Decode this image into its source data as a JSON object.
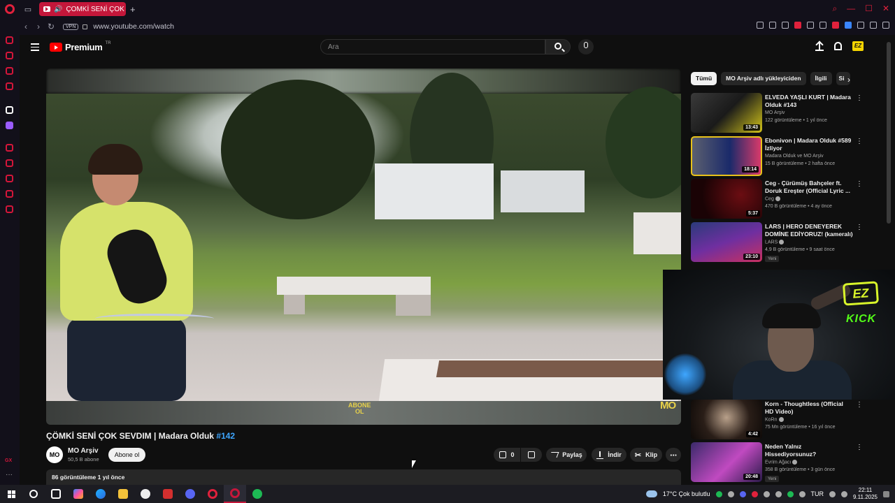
{
  "browser": {
    "tab_title": "ÇOMKİ SENİ ÇOK SEV",
    "new_tab_symbol": "+",
    "vpn_label": "VPN",
    "url": "www.youtube.com/watch",
    "accent_color": "#c4173a"
  },
  "header": {
    "logo_text": "Premium",
    "logo_region": "TR",
    "search_placeholder": "Ara"
  },
  "video": {
    "title": "ÇÖMKİ SENİ ÇOK SEVDIM | Madara Olduk",
    "tag": "#142",
    "watermark": "MO",
    "channel_name": "MO Arşiv",
    "channel_subs": "50,5 B abone",
    "channel_avatar": "MO",
    "subscribe_label": "Abone ol",
    "likes": "0",
    "share_label": "Paylaş",
    "download_label": "İndir",
    "clip_label": "Klip",
    "views_line": "86 görüntüleme  1 yıl önce"
  },
  "chips": [
    "Tümü",
    "MO Arşiv adlı yükleyiciden",
    "İlgili",
    "Si"
  ],
  "recommendations": [
    {
      "title": "ELVEDA YAŞLI KURT | Madara Olduk #143",
      "channel": "MO Arşiv",
      "meta": "122 görüntüleme • 1 yıl önce",
      "duration": "13:43",
      "verified": false,
      "badge": ""
    },
    {
      "title": "Ebonivon | Madara Olduk #589 İzliyor",
      "channel": "Madara Olduk ve MO Arşiv",
      "meta": "15 B görüntüleme • 2 hafta önce",
      "duration": "18:14",
      "verified": false,
      "badge": ""
    },
    {
      "title": "Ceg - Çürümüş Bahçeler ft. Doruk Ereşter (Official Lyric ...",
      "channel": "Ceg",
      "meta": "470 B görüntüleme • 4 ay önce",
      "duration": "5:37",
      "verified": true,
      "badge": ""
    },
    {
      "title": "LARS | HERO DENEYEREK DOMİNE EDİYORUZ! (kameralı)",
      "channel": "LARS",
      "meta": "4,9 B görüntüleme • 9 saat önce",
      "duration": "23:10",
      "verified": true,
      "badge": "Yeni"
    },
    {
      "title": "Korn - Thoughtless (Official HD Video)",
      "channel": "KoRn",
      "meta": "75 Mn görüntüleme • 16 yıl önce",
      "duration": "4:42",
      "verified": true,
      "badge": ""
    },
    {
      "title": "Neden Yalnız Hissediyorsunuz?",
      "channel": "Evrim Ağacı",
      "meta": "358 B görüntüleme • 3 gün önce",
      "duration": "20:48",
      "verified": true,
      "badge": "Yeni"
    }
  ],
  "webcam": {
    "logo_text": "EZ",
    "kick_text": "KICK"
  },
  "taskbar": {
    "weather": "17°C  Çok bulutlu",
    "language": "TUR",
    "time": "22:11",
    "date": "9.11.2025"
  }
}
